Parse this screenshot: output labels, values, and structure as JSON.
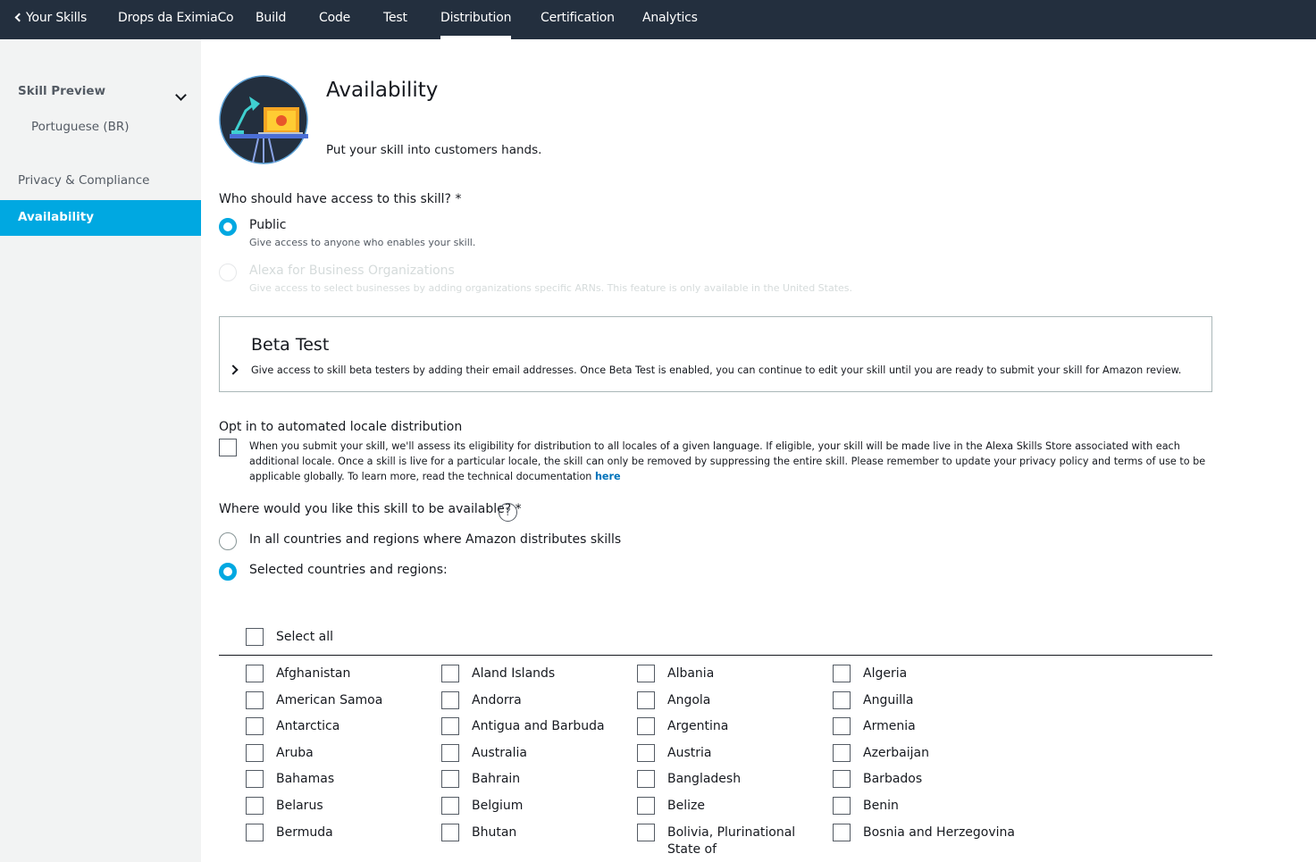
{
  "topnav": {
    "back_label": "Your Skills",
    "items": [
      "Drops da EximiaCo",
      "Build",
      "Code",
      "Test",
      "Distribution",
      "Certification",
      "Analytics"
    ],
    "active": "Distribution"
  },
  "sidebar": {
    "skill_preview": "Skill Preview",
    "locale": "Portuguese (BR)",
    "privacy": "Privacy & Compliance",
    "availability": "Availability"
  },
  "header": {
    "title": "Availability",
    "subtitle": "Put your skill into customers hands."
  },
  "access": {
    "question": "Who should have access to this skill? *",
    "public_label": "Public",
    "public_desc": "Give access to anyone who enables your skill.",
    "business_label": "Alexa for Business Organizations",
    "business_desc": "Give access to select businesses by adding organizations specific ARNs. This feature is only available in the United States.",
    "selected": "Public"
  },
  "beta": {
    "title": "Beta Test",
    "desc": "Give access to skill beta testers by adding their email addresses. Once Beta Test is enabled, you can continue to edit your skill until you are ready to submit your skill for Amazon review."
  },
  "optin": {
    "title": "Opt in to automated locale distribution",
    "text": "When you submit your skill, we'll assess its eligibility for distribution to all locales of a given language. If eligible, your skill will be made live in the Alexa Skills Store associated with each additional locale. Once a skill is live for a particular locale, the skill can only be removed by suppressing the entire skill. Please remember to update your privacy policy and terms of use to be applicable globally. To learn more, read the technical documentation",
    "link": "here",
    "checked": false
  },
  "where": {
    "question": "Where would you like this skill to be available?  *",
    "help": "?",
    "all_label": "In all countries and regions where Amazon distributes skills",
    "selected_label": "Selected countries and regions:",
    "selected": "Selected countries and regions:"
  },
  "countries": {
    "select_all": "Select all",
    "rows": [
      [
        "Afghanistan",
        "Aland Islands",
        "Albania",
        "Algeria"
      ],
      [
        "American Samoa",
        "Andorra",
        "Angola",
        "Anguilla"
      ],
      [
        "Antarctica",
        "Antigua and Barbuda",
        "Argentina",
        "Armenia"
      ],
      [
        "Aruba",
        "Australia",
        "Austria",
        "Azerbaijan"
      ],
      [
        "Bahamas",
        "Bahrain",
        "Bangladesh",
        "Barbados"
      ],
      [
        "Belarus",
        "Belgium",
        "Belize",
        "Benin"
      ],
      [
        "Bermuda",
        "Bhutan",
        "Bolivia, Plurinational State of",
        "Bosnia and Herzegovina"
      ]
    ]
  },
  "colors": {
    "nav_bg": "#232f3e",
    "accent": "#00a8e1",
    "link": "#0073bb",
    "sidebar_bg": "#f2f3f3"
  }
}
